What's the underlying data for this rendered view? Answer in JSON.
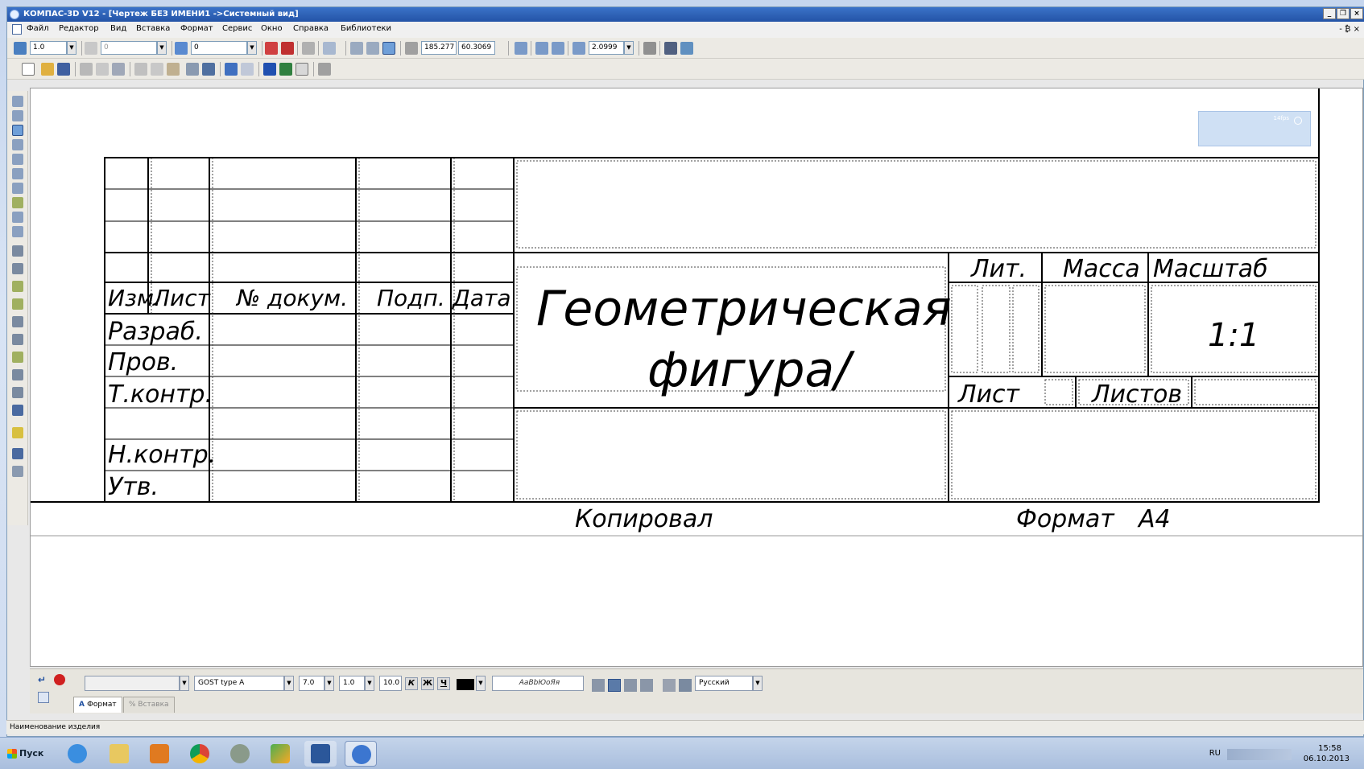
{
  "window": {
    "title": "КОМПАС-3D V12 - [Чертеж БЕЗ ИМЕНИ1 ->Системный вид]",
    "controls": {
      "minimize": "_",
      "restore": "❐",
      "close": "×"
    },
    "mdi_controls": "- ₿ ×"
  },
  "menu": [
    "Файл",
    "Редактор",
    "Вид",
    "Вставка",
    "Формат",
    "Сервис",
    "Окно",
    "Справка",
    "Библиотеки"
  ],
  "toolbar_current": {
    "step_value": "1.0",
    "layer_value": "0",
    "style_value": "0",
    "coord_x": "185.277",
    "coord_y": "60.3069",
    "zoom_value": "2.0999"
  },
  "mini_panel": {
    "label": "14fps"
  },
  "title_block": {
    "columns": [
      "Изм.",
      "Лист",
      "№ докум.",
      "Подп.",
      "Дата"
    ],
    "rows": [
      "Разраб.",
      "Пров.",
      "Т.контр.",
      "",
      "Н.контр.",
      "Утв."
    ],
    "product_name": [
      "Геометрическая",
      "фигура/"
    ],
    "lit_label": "Лит.",
    "mass_label": "Масса",
    "scale_label": "Масштаб",
    "scale_value": "1:1",
    "sheet_label": "Лист",
    "sheets_label": "Листов",
    "copied_label": "Копировал",
    "format_label": "Формат",
    "format_value": "A4"
  },
  "properties": {
    "style_field": "",
    "font": "GOST type A",
    "height": "7.0",
    "narrowing": "1.0",
    "spacing": "10.0",
    "italic": "К",
    "bold": "Ж",
    "underline": "Ч",
    "color": "#000000",
    "sample": "АаBbЮоЯя",
    "language": "Русский",
    "tab_format": "Формат",
    "tab_insert": "Вставка"
  },
  "status": {
    "text": "Наименование изделия"
  },
  "taskbar": {
    "start_label": "Пуск",
    "lang": "RU",
    "time": "15:58",
    "date": "06.10.2013"
  },
  "colors": {
    "titlebar": "#2a5fb8",
    "canvas": "#ffffff",
    "accent": "#3b73c9"
  }
}
